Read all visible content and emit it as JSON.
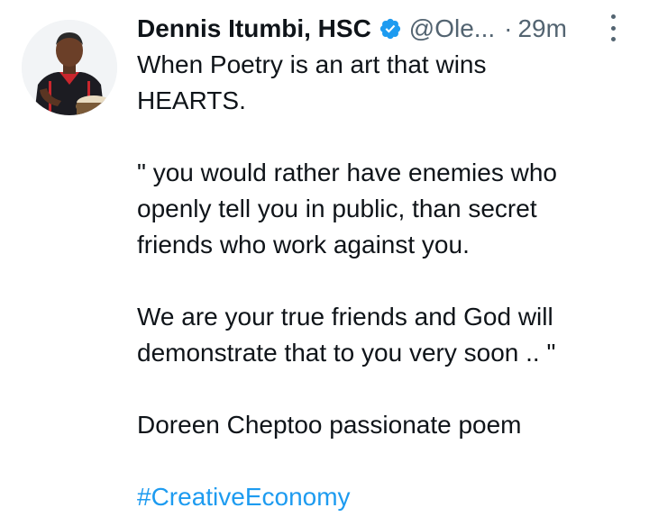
{
  "author": {
    "name": "Dennis Itumbi, HSC",
    "handle": "@Ole...",
    "separator": "·",
    "time": "29m"
  },
  "icons": {
    "verified": "verified-badge-icon",
    "more": "more-options-icon",
    "avatar": "profile-photo"
  },
  "colors": {
    "text": "#0f1419",
    "secondary": "#536471",
    "accent": "#1d9bf0"
  },
  "tweet": {
    "lines": [
      "When Poetry is an art that wins",
      "HEARTS.",
      "\" you would rather have enemies who",
      "openly tell you in public, than secret",
      "friends who work against you.",
      "We are your true friends and God will",
      "demonstrate that to you very soon .. \"",
      "Doreen Cheptoo passionate poem"
    ],
    "hashtag": "#CreativeEconomy"
  }
}
